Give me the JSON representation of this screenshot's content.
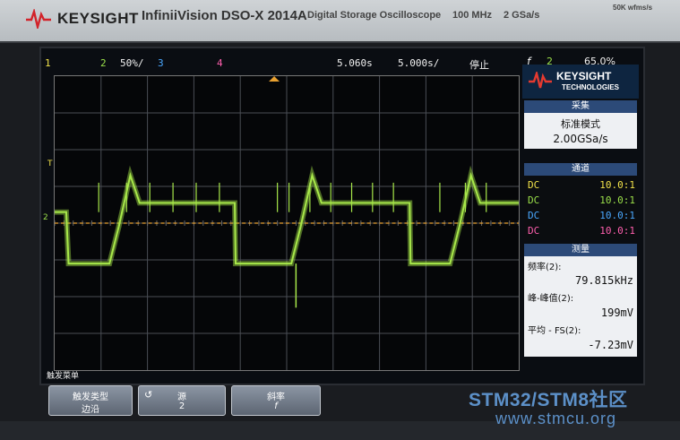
{
  "header": {
    "brand": "KEYSIGHT",
    "model": "InfiniiVision DSO-X 2014A",
    "description": "Digital Storage Oscilloscope",
    "bandwidth": "100 MHz",
    "sample_rate": "2 GSa/s",
    "wfms": "50K wfms/s"
  },
  "status_bar": {
    "ch1_label": "1",
    "ch2_label": "2",
    "ch2_scale": "50%/",
    "ch3_label": "3",
    "ch4_label": "4",
    "delay": "5.060s",
    "timebase": "5.000s/",
    "run_state": "停止",
    "trigger_icon": "f",
    "trigger_source": "2",
    "trigger_level": "65.0%"
  },
  "waveform": {
    "channel": "2",
    "color": "#a8e84a",
    "period_div": 3.5,
    "high_div": -0.55,
    "low_div": 1.1,
    "overshoot_div": -1.3,
    "undershoot_div": 2.3,
    "edges": [
      {
        "rise": 1.28,
        "fall": 3.88
      },
      {
        "rise": 5.2,
        "fall": 7.65
      },
      {
        "rise": 8.62
      }
    ],
    "start_level": "high",
    "spikes": [
      0.95,
      1.55,
      2.05,
      2.55,
      3.05,
      3.55,
      4.8,
      5.05,
      5.5,
      5.95,
      6.4,
      6.85,
      7.3,
      8.3,
      8.85,
      9.3
    ]
  },
  "markers": {
    "trigger_T": "T",
    "ch2_ground": "2"
  },
  "colors": {
    "ch1": "#f2e34a",
    "ch2": "#9be04a",
    "ch3": "#4aa8ff",
    "ch4": "#ff5fae",
    "trigger_level_line": "#e8a030"
  },
  "panel": {
    "logo_line1": "KEYSIGHT",
    "logo_line2": "TECHNOLOGIES",
    "acquire": {
      "title": "采集",
      "mode": "标准模式",
      "rate": "2.00GSa/s"
    },
    "channels": {
      "title": "通道",
      "rows": [
        {
          "coupling": "DC",
          "ratio": "10.0:1"
        },
        {
          "coupling": "DC",
          "ratio": "10.0:1"
        },
        {
          "coupling": "DC",
          "ratio": "10.0:1"
        },
        {
          "coupling": "DC",
          "ratio": "10.0:1"
        }
      ]
    },
    "measure": {
      "title": "测量",
      "items": [
        {
          "label": "频率(2):",
          "value": "79.815kHz"
        },
        {
          "label": "峰-峰值(2):",
          "value": "199mV"
        },
        {
          "label": "平均 - FS(2):",
          "value": "-7.23mV"
        }
      ]
    }
  },
  "softkeys": {
    "menu_title": "触发菜单",
    "keys": [
      {
        "line1": "触发类型",
        "line2": "边沿"
      },
      {
        "line1": "源",
        "line2": "2"
      },
      {
        "line1": "斜率",
        "line2": "f"
      }
    ]
  },
  "watermark": {
    "line1": "STM32/STM8社区",
    "line2": "www.stmcu.org"
  }
}
